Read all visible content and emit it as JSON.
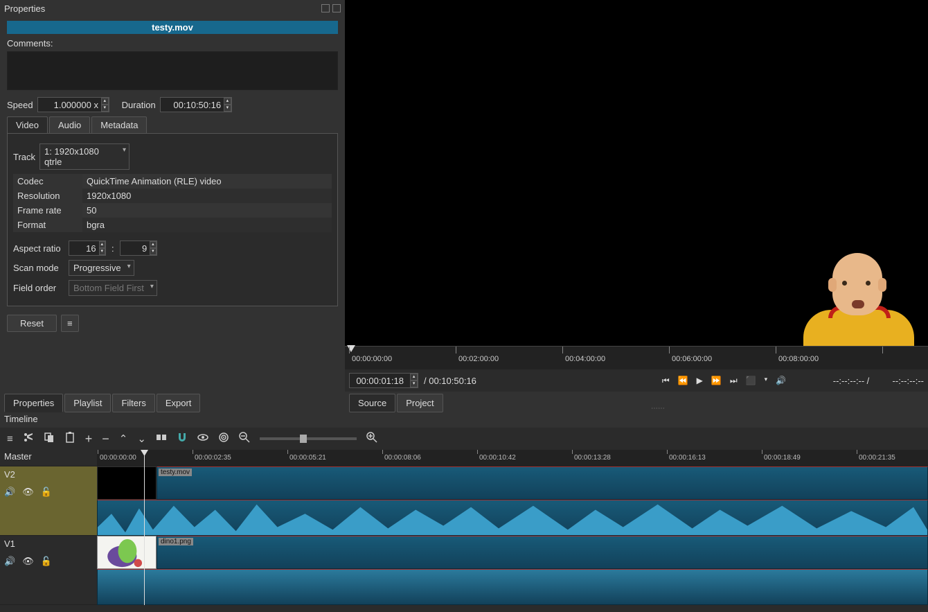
{
  "properties": {
    "panel_title": "Properties",
    "file_name": "testy.mov",
    "comments_label": "Comments:",
    "speed_label": "Speed",
    "speed_value": "1.000000 x",
    "duration_label": "Duration",
    "duration_value": "00:10:50:16",
    "tabs": {
      "video": "Video",
      "audio": "Audio",
      "metadata": "Metadata"
    },
    "track_label": "Track",
    "track_value": "1: 1920x1080 qtrle",
    "table": {
      "codec_k": "Codec",
      "codec_v": "QuickTime Animation (RLE) video",
      "res_k": "Resolution",
      "res_v": "1920x1080",
      "fr_k": "Frame rate",
      "fr_v": "50",
      "fmt_k": "Format",
      "fmt_v": "bgra"
    },
    "aspect_label": "Aspect ratio",
    "aspect_w": "16",
    "aspect_h": "9",
    "scan_label": "Scan mode",
    "scan_value": "Progressive",
    "field_label": "Field order",
    "field_value": "Bottom Field First",
    "reset": "Reset",
    "menu": "≡"
  },
  "bottom_tabs": {
    "properties": "Properties",
    "playlist": "Playlist",
    "filters": "Filters",
    "export": "Export"
  },
  "preview": {
    "ruler": [
      "00:00:00:00",
      "00:02:00:00",
      "00:04:00:00",
      "00:06:00:00",
      "00:08:00:00"
    ],
    "curtime": "00:00:01:18",
    "total": "/ 00:10:50:16",
    "in": "--:--:--:--",
    "sep": "/",
    "out": "--:--:--:--",
    "source": "Source",
    "project": "Project"
  },
  "timeline": {
    "title": "Timeline",
    "master": "Master",
    "v2": "V2",
    "v1": "V1",
    "ruler": [
      "00:00:00:00",
      "00:00:02:35",
      "00:00:05:21",
      "00:00:08:06",
      "00:00:10:42",
      "00:00:13:28",
      "00:00:16:13",
      "00:00:18:49",
      "00:00:21:35"
    ],
    "clip1": "testy.mov",
    "clip2": "dino1.png"
  }
}
